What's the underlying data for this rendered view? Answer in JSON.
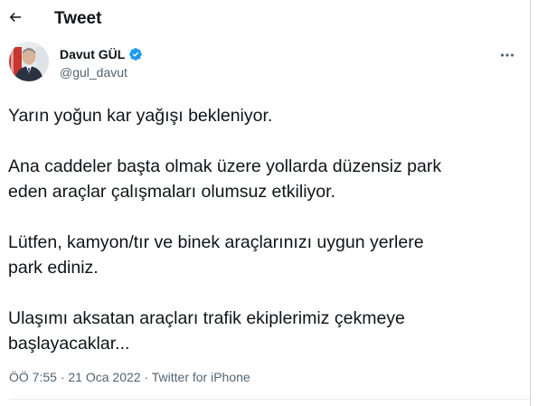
{
  "header": {
    "title": "Tweet",
    "back_icon": "arrow-left-icon"
  },
  "author": {
    "display_name": "Davut GÜL",
    "handle": "@gul_davut",
    "verified_icon": "verified-badge-icon",
    "verified_color": "#1d9bf0"
  },
  "more_icon": "more-horizontal-icon",
  "tweet": {
    "paragraphs": [
      "Yarın yoğun kar yağışı bekleniyor.",
      "Ana caddeler başta olmak üzere yollarda düzensiz park\neden araçlar çalışmaları olumsuz etkiliyor.",
      "Lütfen, kamyon/tır ve binek araçlarınızı uygun yerlere\npark ediniz.",
      "Ulaşımı aksatan araçları trafik ekiplerimiz çekmeye\nbaşlayacaklar..."
    ]
  },
  "meta": {
    "time": "ÖÖ 7:55",
    "separator": " · ",
    "date": "21 Oca 2022",
    "source": "Twitter for iPhone"
  }
}
